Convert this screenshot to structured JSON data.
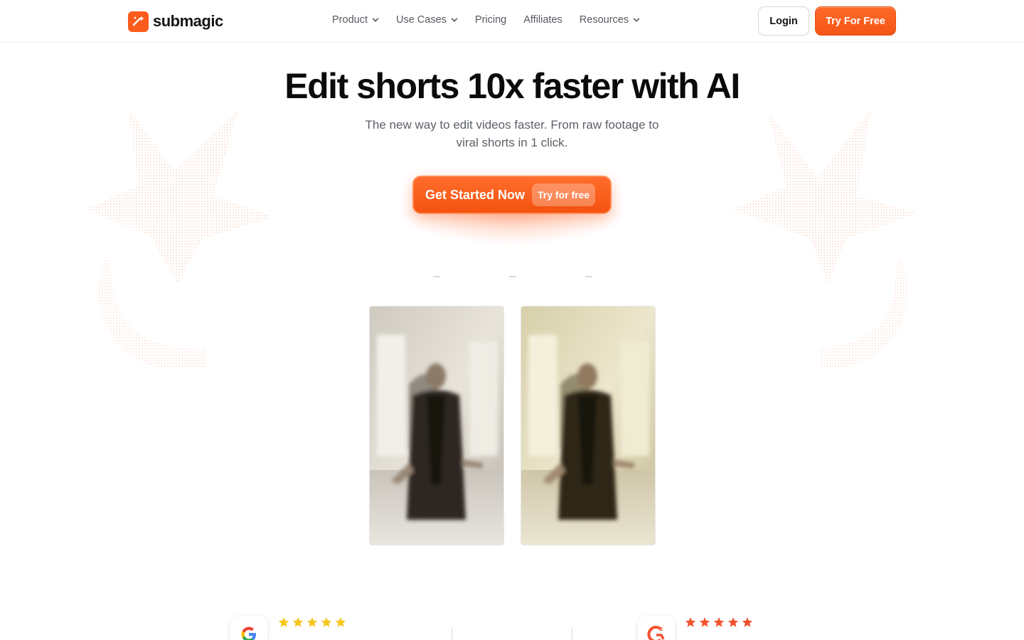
{
  "brand": {
    "name": "submagic",
    "accent": "#fa5c1d",
    "logo_icon": "sparkle-wand-icon"
  },
  "nav": {
    "items": [
      {
        "label": "Product",
        "has_dropdown": true
      },
      {
        "label": "Use Cases",
        "has_dropdown": true
      },
      {
        "label": "Pricing",
        "has_dropdown": false
      },
      {
        "label": "Affiliates",
        "has_dropdown": false
      },
      {
        "label": "Resources",
        "has_dropdown": true
      }
    ],
    "login_label": "Login",
    "try_label": "Try For Free"
  },
  "hero": {
    "title": "Edit shorts 10x faster with AI",
    "subtitle_line1": "The new way to edit videos faster. From raw footage to",
    "subtitle_line2": "viral shorts in 1 click.",
    "cta_label": "Get Started Now",
    "cta_pill": "Try for free"
  },
  "reviews": [
    {
      "platform_icon": "google-g-icon",
      "stars": 5,
      "star_color": "#f5c518"
    },
    {
      "platform_icon": "g2-icon",
      "stars": 5,
      "star_color": "#f4522f"
    }
  ]
}
